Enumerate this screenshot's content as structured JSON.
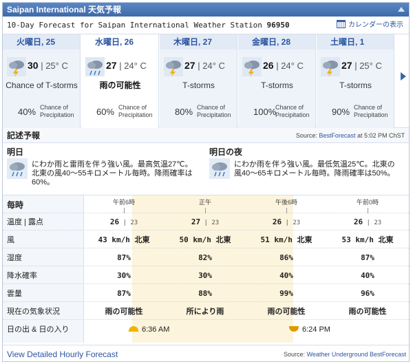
{
  "title": "Saipan International 天気予報",
  "subtitle_prefix": "10-Day Forecast for Saipan International Weather Station",
  "station_id": "96950",
  "calendar_label": "カレンダーの表示",
  "days": [
    {
      "name": "火曜日, 25",
      "high": "30",
      "low": "25° C",
      "condition": "Chance of T-storms",
      "precip": "40%",
      "precip_label": "Chance of Precipitation",
      "icon": "tstorm-cloud-icon"
    },
    {
      "name": "水曜日, 26",
      "high": "27",
      "low": "24° C",
      "condition": "雨の可能性",
      "precip": "60%",
      "precip_label": "Chance of Precipitation",
      "icon": "rain-cloud-icon"
    },
    {
      "name": "木曜日, 27",
      "high": "27",
      "low": "24° C",
      "condition": "T-storms",
      "precip": "80%",
      "precip_label": "Chance of Precipitation",
      "icon": "tstorm-cloud-icon"
    },
    {
      "name": "金曜日, 28",
      "high": "26",
      "low": "24° C",
      "condition": "T-storms",
      "precip": "100%",
      "precip_label": "Chance of Precipitation",
      "icon": "tstorm-cloud-icon"
    },
    {
      "name": "土曜日, 1",
      "high": "27",
      "low": "25° C",
      "condition": "T-storms",
      "precip": "90%",
      "precip_label": "Chance of Precipitation",
      "icon": "tstorm-cloud-icon"
    }
  ],
  "narrative": {
    "heading": "記述予報",
    "source_prefix": "Source:",
    "source_link": "BestForecast",
    "source_suffix": "at 5:02 PM ChST",
    "today_title": "明日",
    "today_text": "にわか雨と雷雨を伴う強い風。最高気温27℃。北東の風40～55キロメートル毎時。降雨確率は60%。",
    "night_title": "明日の夜",
    "night_text": "にわか雨を伴う強い風。最低気温25℃。北東の風40～65キロメートル毎時。降雨確率は50%。"
  },
  "hourly": {
    "header_label": "毎時",
    "times": [
      "午前6時",
      "正午",
      "午後6時",
      "午前0時"
    ],
    "rows": [
      {
        "label": "温度 | 露点",
        "values": [
          [
            "26",
            "23"
          ],
          [
            "27",
            "23"
          ],
          [
            "26",
            "23"
          ],
          [
            "26",
            "23"
          ]
        ]
      },
      {
        "label": "風",
        "values": [
          "43 km/h 北東",
          "50 km/h 北東",
          "51 km/h 北東",
          "53 km/h 北東"
        ]
      },
      {
        "label": "湿度",
        "values": [
          "87%",
          "82%",
          "86%",
          "87%"
        ]
      },
      {
        "label": "降水確率",
        "values": [
          "30%",
          "30%",
          "40%",
          "40%"
        ]
      },
      {
        "label": "雲量",
        "values": [
          "87%",
          "88%",
          "99%",
          "96%"
        ]
      },
      {
        "label": "現在の気象状況",
        "values": [
          "雨の可能性",
          "所により雨",
          "雨の可能性",
          "雨の可能性"
        ]
      }
    ],
    "sun_label": "日の出 & 日の入り",
    "sunrise": "6:36 AM",
    "sunset": "6:24 PM"
  },
  "footer": {
    "link": "View Detailed Hourly Forecast",
    "source_prefix": "Source:",
    "source_link": "Weather Underground BestForecast"
  },
  "colors": {
    "accent": "#2b55a0",
    "title_bar": "#4a76b6",
    "shade": "#fcf4dc",
    "sun": "#f0b400"
  }
}
